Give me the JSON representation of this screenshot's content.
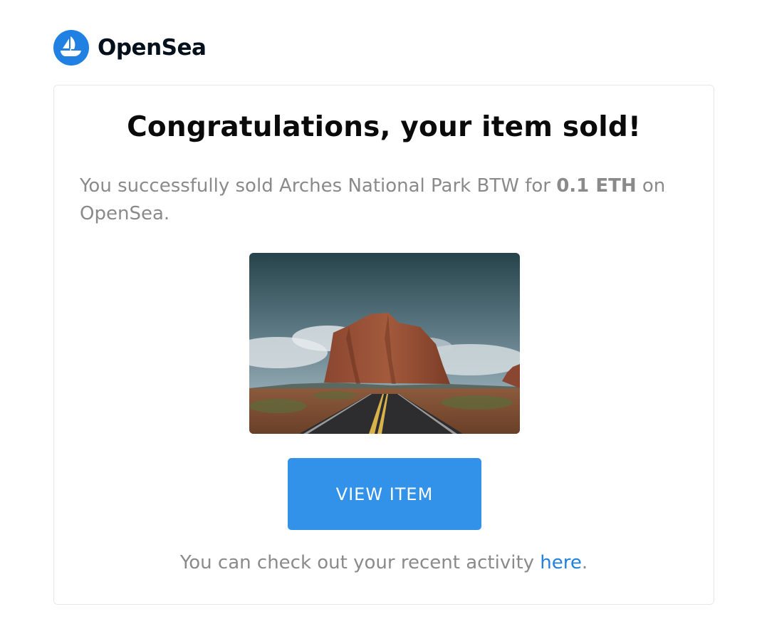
{
  "brand": {
    "name": "OpenSea",
    "logo_icon": "opensea-ship-icon",
    "accent_color": "#2081e2"
  },
  "email": {
    "headline": "Congratulations, your item sold!",
    "message": {
      "prefix": "You successfully sold Arches National Park BTW for ",
      "price": "0.1 ETH",
      "suffix": " on OpenSea."
    },
    "item_image_alt": "Arches National Park BTW",
    "view_button_label": "VIEW ITEM",
    "button_color": "#3291e9",
    "footer": {
      "prefix": "You can check out your recent activity ",
      "link_text": "here",
      "suffix": "."
    }
  }
}
